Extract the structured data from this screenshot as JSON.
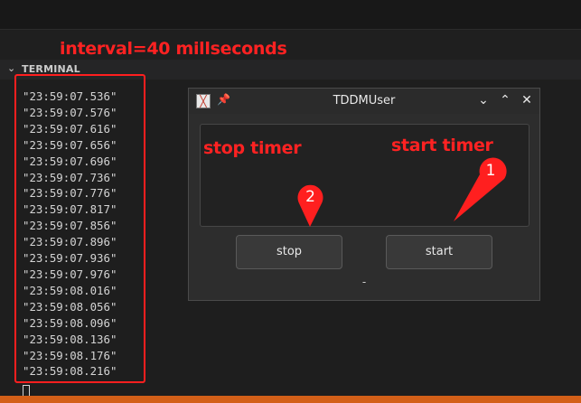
{
  "annotation": {
    "interval_text": "interval=40 millseconds",
    "stop_timer_text": "stop timer",
    "start_timer_text": "start timer",
    "marker_1": "1",
    "marker_2": "2",
    "color": "#ff2222"
  },
  "panel": {
    "title": "TERMINAL",
    "chevron_icon": "chevron-down-icon"
  },
  "terminal": {
    "lines": [
      "\"23:59:07.536\"",
      "\"23:59:07.576\"",
      "\"23:59:07.616\"",
      "\"23:59:07.656\"",
      "\"23:59:07.696\"",
      "\"23:59:07.736\"",
      "\"23:59:07.776\"",
      "\"23:59:07.817\"",
      "\"23:59:07.856\"",
      "\"23:59:07.896\"",
      "\"23:59:07.936\"",
      "\"23:59:07.976\"",
      "\"23:59:08.016\"",
      "\"23:59:08.056\"",
      "\"23:59:08.096\"",
      "\"23:59:08.136\"",
      "\"23:59:08.176\"",
      "\"23:59:08.216\""
    ]
  },
  "window": {
    "title": "TDDMUser",
    "app_icon": "app-icon",
    "pin_icon": "pin-icon",
    "min_glyph": "⌄",
    "max_glyph": "⌃",
    "close_glyph": "✕",
    "stop_label": "stop",
    "start_label": "start",
    "status_text": "-"
  }
}
